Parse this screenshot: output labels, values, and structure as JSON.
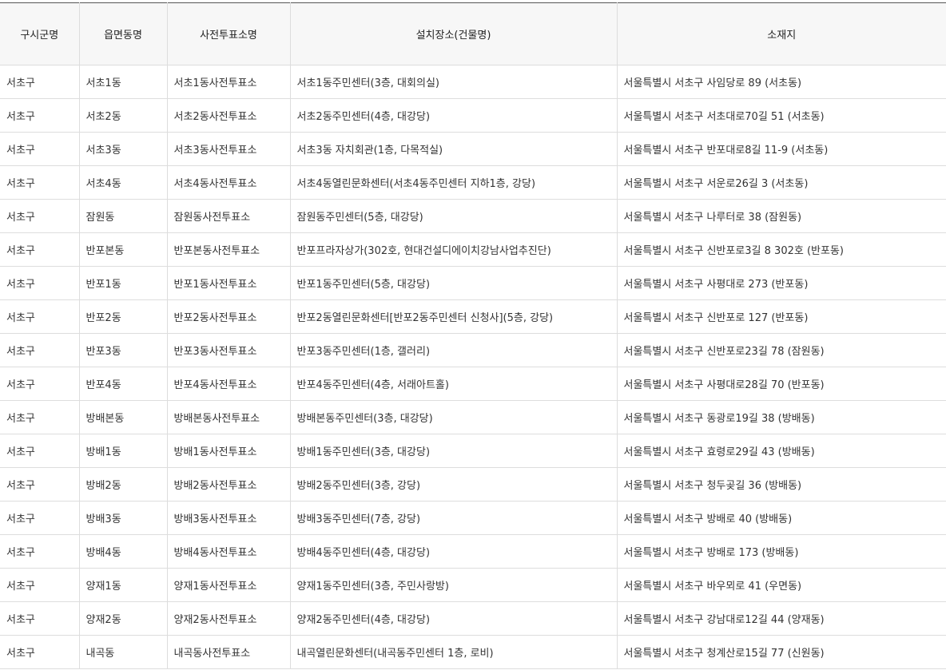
{
  "table": {
    "headers": [
      "구시군명",
      "읍면동명",
      "사전투표소명",
      "설치장소(건물명)",
      "소재지"
    ],
    "rows": [
      [
        "서초구",
        "서초1동",
        "서초1동사전투표소",
        "서초1동주민센터(3층, 대회의실)",
        "서울특별시 서초구 사임당로 89 (서초동)"
      ],
      [
        "서초구",
        "서초2동",
        "서초2동사전투표소",
        "서초2동주민센터(4층, 대강당)",
        "서울특별시 서초구 서초대로70길 51 (서초동)"
      ],
      [
        "서초구",
        "서초3동",
        "서초3동사전투표소",
        "서초3동 자치회관(1층, 다목적실)",
        "서울특별시 서초구 반포대로8길 11-9 (서초동)"
      ],
      [
        "서초구",
        "서초4동",
        "서초4동사전투표소",
        "서초4동열린문화센터(서초4동주민센터 지하1층, 강당)",
        "서울특별시 서초구 서운로26길 3 (서초동)"
      ],
      [
        "서초구",
        "잠원동",
        "잠원동사전투표소",
        "잠원동주민센터(5층, 대강당)",
        "서울특별시 서초구 나루터로 38 (잠원동)"
      ],
      [
        "서초구",
        "반포본동",
        "반포본동사전투표소",
        "반포프라자상가(302호, 현대건설디에이치강남사업추진단)",
        "서울특별시 서초구 신반포로3길 8 302호 (반포동)"
      ],
      [
        "서초구",
        "반포1동",
        "반포1동사전투표소",
        "반포1동주민센터(5층, 대강당)",
        "서울특별시 서초구 사평대로 273 (반포동)"
      ],
      [
        "서초구",
        "반포2동",
        "반포2동사전투표소",
        "반포2동열린문화센터[반포2동주민센터 신청사](5층, 강당)",
        "서울특별시 서초구 신반포로 127 (반포동)"
      ],
      [
        "서초구",
        "반포3동",
        "반포3동사전투표소",
        "반포3동주민센터(1층, 갤러리)",
        "서울특별시 서초구 신반포로23길 78 (잠원동)"
      ],
      [
        "서초구",
        "반포4동",
        "반포4동사전투표소",
        "반포4동주민센터(4층, 서래아트홀)",
        "서울특별시 서초구 사평대로28길 70 (반포동)"
      ],
      [
        "서초구",
        "방배본동",
        "방배본동사전투표소",
        "방배본동주민센터(3층, 대강당)",
        "서울특별시 서초구 동광로19길 38 (방배동)"
      ],
      [
        "서초구",
        "방배1동",
        "방배1동사전투표소",
        "방배1동주민센터(3층, 대강당)",
        "서울특별시 서초구 효령로29길 43 (방배동)"
      ],
      [
        "서초구",
        "방배2동",
        "방배2동사전투표소",
        "방배2동주민센터(3층, 강당)",
        "서울특별시 서초구 청두곶길 36 (방배동)"
      ],
      [
        "서초구",
        "방배3동",
        "방배3동사전투표소",
        "방배3동주민센터(7층, 강당)",
        "서울특별시 서초구 방배로 40 (방배동)"
      ],
      [
        "서초구",
        "방배4동",
        "방배4동사전투표소",
        "방배4동주민센터(4층, 대강당)",
        "서울특별시 서초구 방배로 173 (방배동)"
      ],
      [
        "서초구",
        "양재1동",
        "양재1동사전투표소",
        "양재1동주민센터(3층, 주민사랑방)",
        "서울특별시 서초구 바우뫼로 41 (우면동)"
      ],
      [
        "서초구",
        "양재2동",
        "양재2동사전투표소",
        "양재2동주민센터(4층, 대강당)",
        "서울특별시 서초구 강남대로12길 44 (양재동)"
      ],
      [
        "서초구",
        "내곡동",
        "내곡동사전투표소",
        "내곡열린문화센터(내곡동주민센터 1층, 로비)",
        "서울특별시 서초구 청계산로15길 77 (신원동)"
      ]
    ]
  }
}
